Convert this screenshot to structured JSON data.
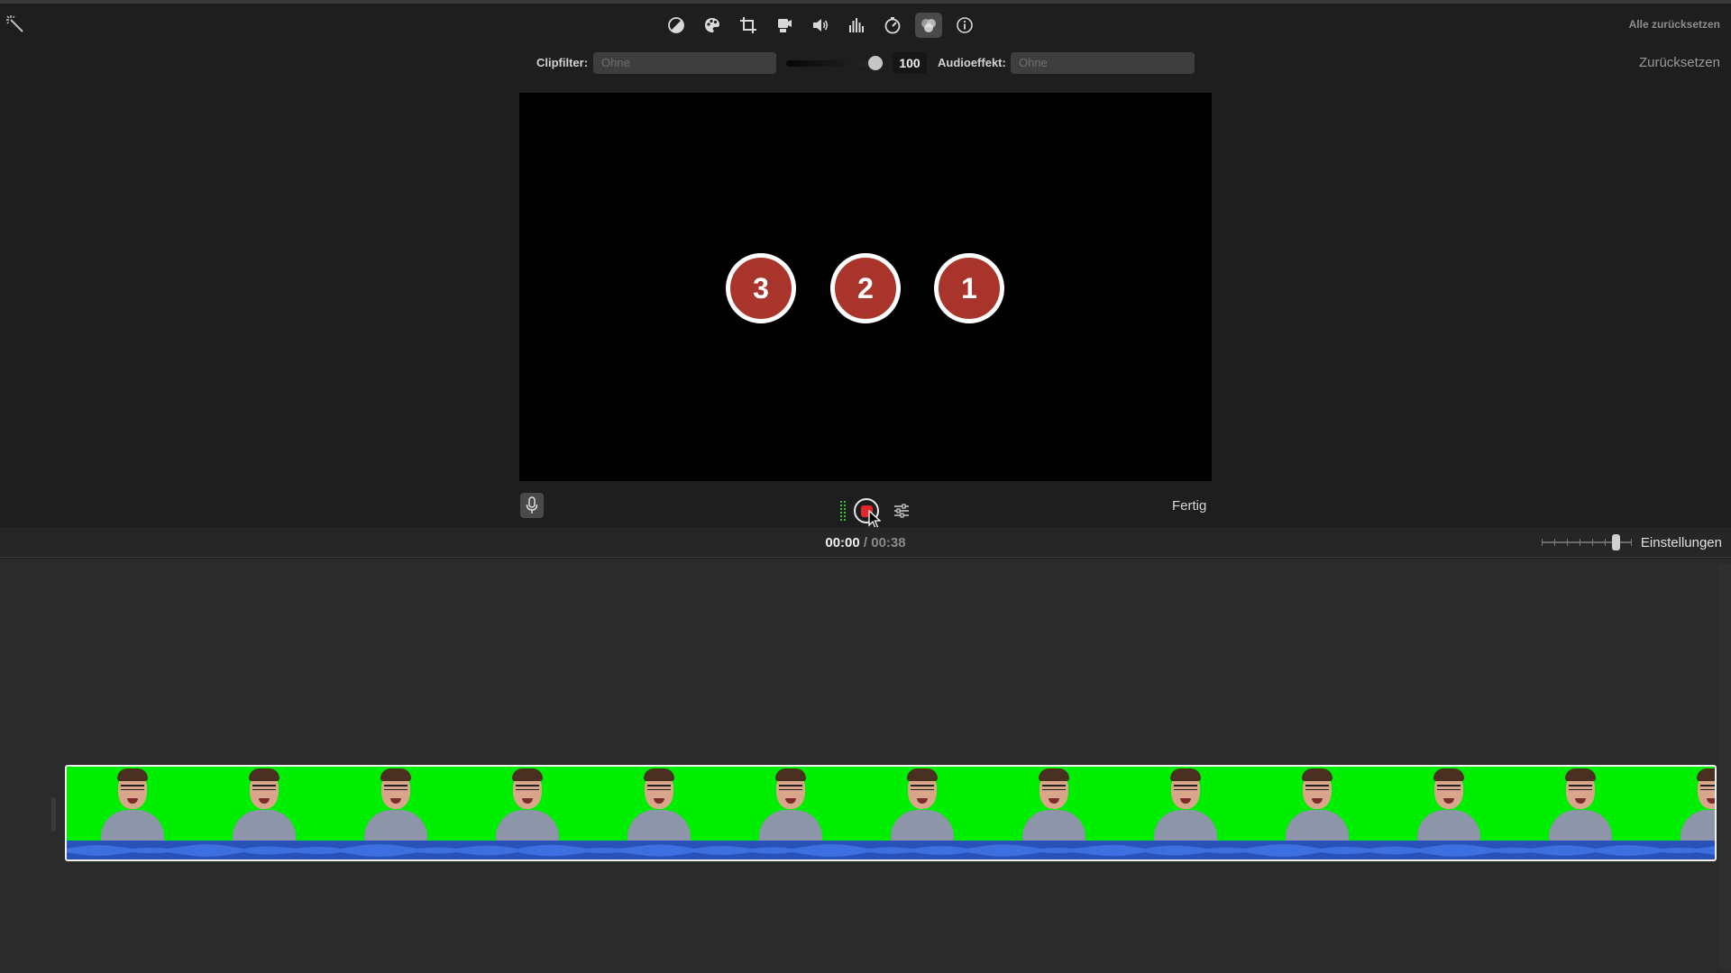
{
  "header": {
    "reset_all_label": "Alle zurücksetzen"
  },
  "toolbar": {
    "tools": [
      {
        "name": "color-balance-icon",
        "active": false
      },
      {
        "name": "color-correction-icon",
        "active": false
      },
      {
        "name": "crop-icon",
        "active": false
      },
      {
        "name": "stabilization-icon",
        "active": false
      },
      {
        "name": "volume-icon",
        "active": false
      },
      {
        "name": "noise-reduction-equalizer-icon",
        "active": false
      },
      {
        "name": "speed-icon",
        "active": false
      },
      {
        "name": "clip-filter-audio-effects-icon",
        "active": true
      },
      {
        "name": "info-icon",
        "active": false
      }
    ]
  },
  "filters": {
    "clip_filter_label": "Clipfilter:",
    "clip_filter_value": "Ohne",
    "volume_value": "100",
    "volume_fraction": 0.92,
    "audio_effect_label": "Audioeffekt:",
    "audio_effect_value": "Ohne",
    "reset_label": "Zurücksetzen"
  },
  "viewer": {
    "countdown": [
      "3",
      "2",
      "1"
    ]
  },
  "recording": {
    "mic_icon": "microphone-icon",
    "record_icon": "record-icon",
    "options_icon": "voiceover-options-icon",
    "done_label": "Fertig"
  },
  "timebar": {
    "current": "00:00",
    "separator": "/",
    "total": "00:38",
    "zoom_fraction": 0.82,
    "settings_label": "Einstellungen"
  },
  "timeline": {
    "clip_thumbnail_count": 13
  },
  "colors": {
    "accent_record": "#e4262a",
    "countdown_fill": "#a8342b",
    "chroma_green": "#00ee00",
    "audio_wave": "#2952b8"
  }
}
